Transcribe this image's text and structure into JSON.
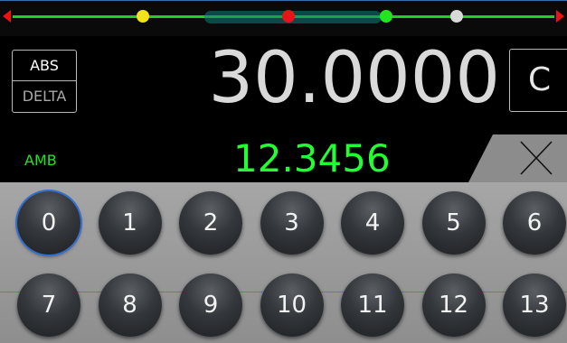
{
  "slider": {
    "markers": [
      {
        "name": "yellow",
        "color": "#f2e21a",
        "position": 0.24
      },
      {
        "name": "red",
        "color": "#e41616",
        "position": 0.51
      },
      {
        "name": "green",
        "color": "#1fe61f",
        "position": 0.69
      },
      {
        "name": "white",
        "color": "#d8d8d8",
        "position": 0.82
      }
    ]
  },
  "mode": {
    "abs_label": "ABS",
    "delta_label": "DELTA"
  },
  "reading": {
    "value": "30.0000",
    "unit": "C"
  },
  "ambient": {
    "label": "AMB",
    "value": "12.3456"
  },
  "clear_icon": "close-icon",
  "keypad": {
    "keys": [
      "0",
      "1",
      "2",
      "3",
      "4",
      "5",
      "6",
      "7",
      "8",
      "9",
      "10",
      "11",
      "12",
      "13"
    ],
    "selected": "0"
  }
}
